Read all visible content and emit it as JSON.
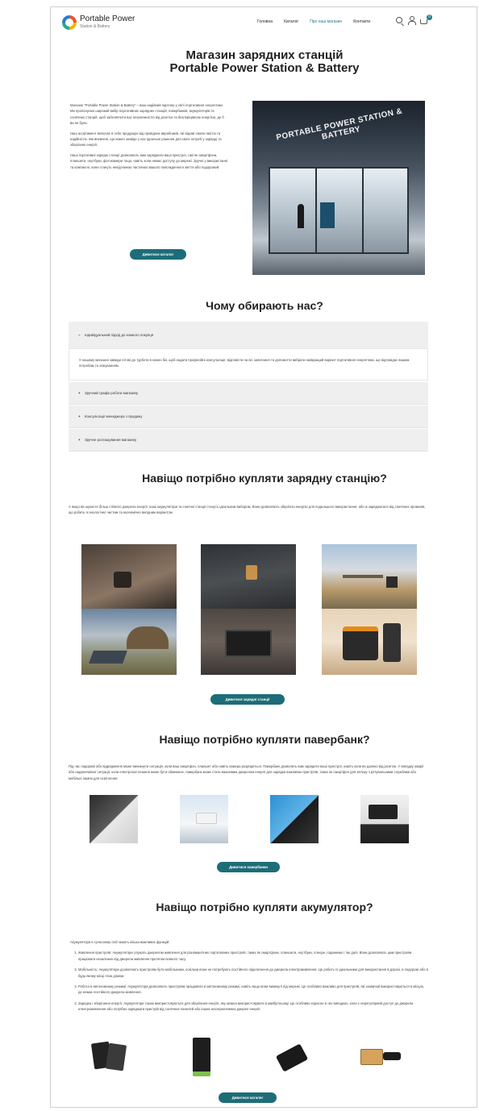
{
  "header": {
    "logo_title": "Portable Power",
    "logo_sub": "Station & Battery",
    "nav": [
      "Головна",
      "Каталог",
      "Про наш магазин",
      "Контакти"
    ],
    "active_nav": "Про наш магазин",
    "cart_count": "0",
    "icons": [
      "search-icon",
      "user-icon",
      "cart-icon"
    ]
  },
  "hero": {
    "title_line1": "Магазин зарядних станцій",
    "title_line2": "Portable Power Station & Battery",
    "intro": [
      "Магазин \"Portable Power Station & Battery\" – ваш надійний партнер у світі портативної енергетики. Ми пропонуємо широкий вибір портативних зарядних станцій, повербанків, акумуляторів та сонячних станцій, щоб забезпечити вас незалежністю від розеток та безперервною енергією, де б ви не були.",
      "Наш асортимент включає в себе продукцію від провідних виробників, які відомі своєю якістю та надійністю. Ми впевнені, що кожен знайде у нас ідеальне рішення для своїх потреб у зарядці та зберіганні енергії.",
      "Наші портативні зарядні станції дозволяють вам заряджати ваші пристрої, такі як смартфони, планшети, ноутбуки, фотокамери тощо, навіть коли немає доступу до мережі. Зручні у використанні та компактні, вони стануть невід'ємною частиною вашого повсякденного життя або подорожей."
    ],
    "image_sign": "PORTABLE POWER STATION & BATTERY",
    "button": "Дивитися каталог"
  },
  "why": {
    "title": "Чому обирають нас?",
    "items": [
      {
        "label": "Індивідуальний підхід до кожного покупця",
        "open": true
      },
      {
        "label": "Зручний графік роботи магазину",
        "open": false
      },
      {
        "label": "Консультації менеджера з продажу",
        "open": false
      },
      {
        "label": "Зручне розташування магазину",
        "open": false
      }
    ],
    "open_text": "У нашому магазині завжди готові до турботи в кожен бік, щоб надати професійні консультації, відповісти на всі запитання та допомогти вибрати найкращий варіант портативної енергетики, що відповідає вашим потребам та очікуванням.",
    "sign_open": "−",
    "sign_closed": "+"
  },
  "stations": {
    "title": "Навіщо потрібно купляти зарядну станцію?",
    "text": "А якщо ви шукаєте більш стійкого джерела енергії, наші акумулятори та сонячні станції стануть ідеальним вибором. Вони дозволяють зберігати енергію для подальшого використання, або ж заряджатися від сонячних променів, що робить їх екологічно чистим та економічно вигідним варіантом.",
    "button": "Дивитися зарядні станції"
  },
  "powerbanks": {
    "title": "Навіщо потрібно купляти павербанк?",
    "text": "Під час подорожі або відрядження може виникнути ситуація, коли ваш смартфон, планшет або навіть камера розрядяться. Павербанк дозволить вам зарядити ваші пристрої, навіть коли ви далеко від розеток. У випадку аварії або надзвичайної ситуації, коли електропостачання може бути обмежене, павербанк може стати важливим джерелом енергії для зарядки важливих пристроїв, таких як смартфон для зв'язку з рятувальними службами або мобільні лампи для освітлення.",
    "button": "Дивитися павербанки"
  },
  "batteries": {
    "title": "Навіщо потрібно купляти акумулятор?",
    "lead": "Акумулятори в сучасному світі мають кілька важливих функцій:",
    "items": [
      "Живлення пристроїв: Акумулятори служать джерелом живлення для різноманітних портативних пристроїв, таких як смартфони, планшети, ноутбуки, плеєри, годинники і так далі. Вони дозволяють цим пристроям працювати незалежно від джерела живлення протягом певного часу.",
      "Мобільність: Акумулятори дозволяють пристроям бути мобільними, оскільки вони не потребують постійного підключення до джерела електроживлення. Це робить їх ідеальними для використання в дорозі, в подорожі або в будь-якому місці поза домом.",
      "Робота в автономному режимі: Акумулятори дозволяють пристроям працювати в автономному режимі, навіть якщо вони вимкнуті від мережі. Це особливо важливо для пристроїв, які зазвичай використовуються в місцях, де немає постійного джерела живлення.",
      "Зарядка і зберігання енергії: Акумулятори також використовуються для зберігання енергії, яку можна використовувати в майбутньому. Це особливо корисно в тих випадках, коли є нерегулярний доступ до джерела електроживлення або потрібно заряджати пристрій від сонячних панелей або інших альтернативних джерел енергії."
    ],
    "button": "Дивитися каталог"
  }
}
